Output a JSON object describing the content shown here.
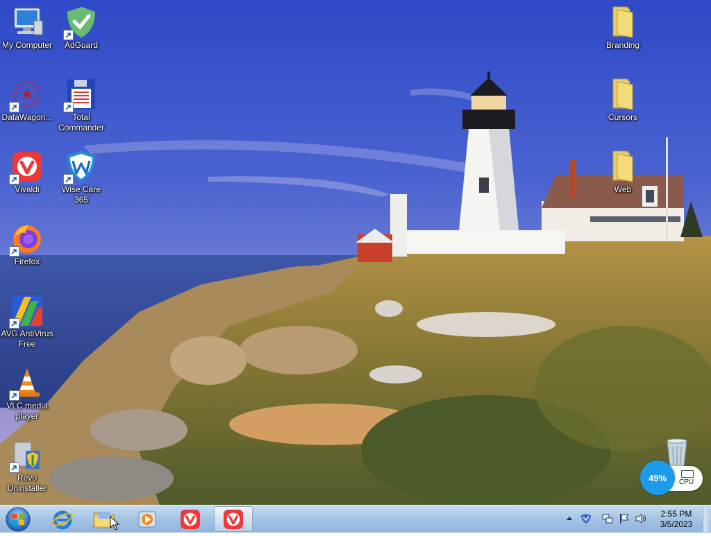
{
  "desktop": {
    "icons_left": [
      {
        "id": "my-computer",
        "label": "My Computer",
        "icon": "computer-icon"
      },
      {
        "id": "adguard",
        "label": "AdGuard",
        "icon": "adguard-shield-icon"
      },
      {
        "id": "datawagon",
        "label": "DataWagon...",
        "icon": "datawagon-icon"
      },
      {
        "id": "total-commander",
        "label": "Total Commander",
        "icon": "floppy-disk-icon"
      },
      {
        "id": "vivaldi",
        "label": "Vivaldi",
        "icon": "vivaldi-icon"
      },
      {
        "id": "wise-care",
        "label": "Wise Care 365",
        "icon": "wise-care-icon"
      },
      {
        "id": "firefox",
        "label": "Firefox",
        "icon": "firefox-icon"
      },
      {
        "id": "avg",
        "label": "AVG AntiVirus Free",
        "icon": "avg-icon"
      },
      {
        "id": "vlc",
        "label": "VLC media player",
        "icon": "vlc-cone-icon"
      },
      {
        "id": "revo",
        "label": "Revo Uninstaller",
        "icon": "revo-uninstaller-icon"
      }
    ],
    "icons_right": [
      {
        "id": "branding",
        "label": "Branding",
        "icon": "folder-icon"
      },
      {
        "id": "cursors",
        "label": "Cursors",
        "icon": "folder-icon"
      },
      {
        "id": "web",
        "label": "Web",
        "icon": "folder-icon"
      },
      {
        "id": "recycle-bin",
        "label": "",
        "icon": "recycle-bin-icon"
      }
    ]
  },
  "cpu_widget": {
    "percent": "49%",
    "label": "CPU",
    "color": "#1e9be8"
  },
  "taskbar": {
    "items": [
      {
        "id": "ie",
        "icon": "internet-explorer-icon"
      },
      {
        "id": "explorer",
        "icon": "folder-icon"
      },
      {
        "id": "media",
        "icon": "media-player-icon"
      },
      {
        "id": "vivaldi-1",
        "icon": "vivaldi-icon"
      },
      {
        "id": "vivaldi-2",
        "icon": "vivaldi-icon",
        "active": true
      }
    ],
    "clock": {
      "time": "2:55 PM",
      "date": "3/5/2023"
    }
  },
  "colors": {
    "vivaldi": "#ef3939",
    "adguard": "#68bc71",
    "taskbar": "#a7c6e6"
  }
}
